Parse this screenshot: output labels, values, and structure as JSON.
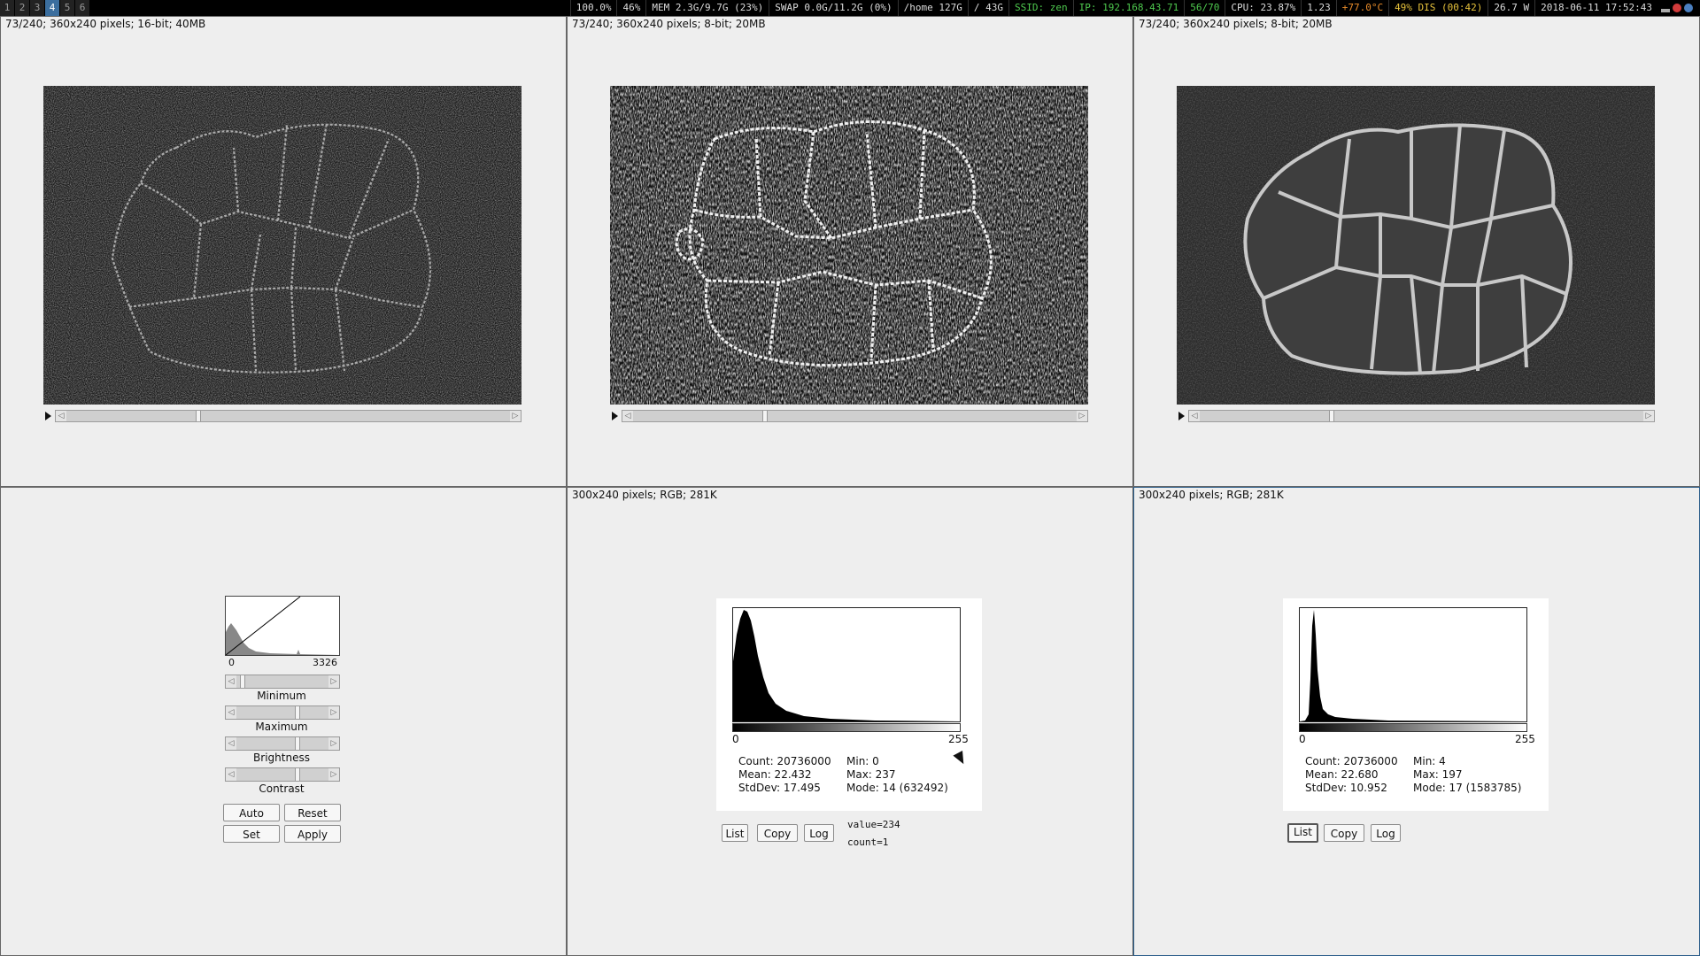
{
  "topbar": {
    "workspaces": [
      "1",
      "2",
      "3",
      "4",
      "5",
      "6"
    ],
    "active_workspace": "4",
    "status": {
      "zoom": "100.0%",
      "brightness": "46%",
      "mem": "MEM 2.3G/9.7G (23%)",
      "swap": "SWAP 0.0G/11.2G (0%)",
      "home": "/home 127G",
      "root": "/ 43G",
      "ssid": "SSID: zen",
      "ip": "IP: 192.168.43.71",
      "wifi": "56/70",
      "cpu": "CPU: 23.87%",
      "load": "1.23",
      "temp": "+77.0°C",
      "battery": "49% DIS (00:42)",
      "power": "26.7 W",
      "datetime": "2018-06-11 17:52:43"
    },
    "colors": {
      "green": "#4ec94e",
      "yellow": "#e6c23c",
      "orange": "#e88b2a",
      "active_ws": "#3b6e9e"
    }
  },
  "panes": {
    "image1": {
      "info": "73/240; 360x240 pixels; 16-bit; 40MB",
      "slider_pos": 0.3
    },
    "image2": {
      "info": "73/240; 360x240 pixels; 8-bit; 20MB",
      "slider_pos": 0.3
    },
    "image3": {
      "info": "73/240; 360x240 pixels; 8-bit; 20MB",
      "slider_pos": 0.3
    }
  },
  "bc": {
    "hist_min": "0",
    "hist_max": "3326",
    "sliders": [
      {
        "name": "Minimum",
        "pos": 0.05
      },
      {
        "name": "Maximum",
        "pos": 0.55
      },
      {
        "name": "Brightness",
        "pos": 0.55
      },
      {
        "name": "Contrast",
        "pos": 0.55
      }
    ],
    "buttons": {
      "auto": "Auto",
      "reset": "Reset",
      "set": "Set",
      "apply": "Apply"
    }
  },
  "hist2": {
    "info": "300x240 pixels; RGB; 281K",
    "axis_min": "0",
    "axis_max": "255",
    "count": "Count: 20736000",
    "mean": "Mean: 22.432",
    "stddev": "StdDev: 17.495",
    "min": "Min: 0",
    "max": "Max: 237",
    "mode": "Mode: 14 (632492)",
    "value": "value=234",
    "count_val": "count=1",
    "buttons": {
      "list": "List",
      "copy": "Copy",
      "log": "Log"
    }
  },
  "hist3": {
    "info": "300x240 pixels; RGB; 281K",
    "axis_min": "0",
    "axis_max": "255",
    "count": "Count: 20736000",
    "mean": "Mean: 22.680",
    "stddev": "StdDev: 10.952",
    "min": "Min: 4",
    "max": "Max: 197",
    "mode": "Mode: 17 (1583785)",
    "buttons": {
      "list": "List",
      "copy": "Copy",
      "log": "Log"
    }
  }
}
